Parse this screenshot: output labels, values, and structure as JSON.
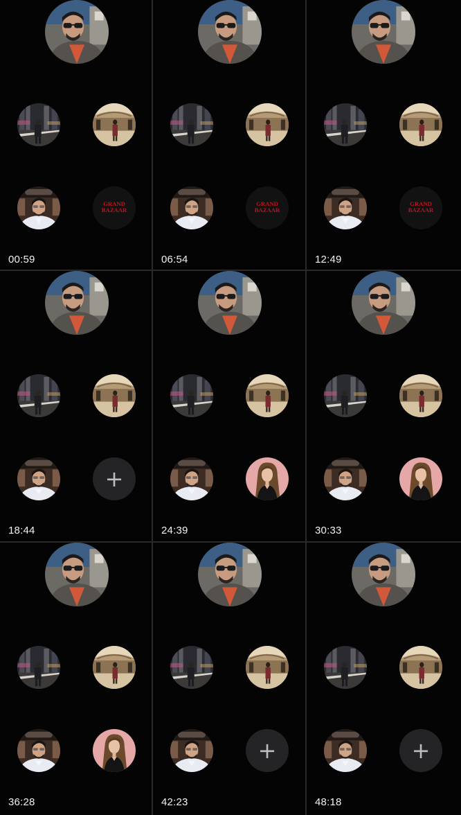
{
  "frames": [
    {
      "timestamp": "00:59",
      "slot4": "grand-bazaar"
    },
    {
      "timestamp": "06:54",
      "slot4": "grand-bazaar"
    },
    {
      "timestamp": "12:49",
      "slot4": "grand-bazaar"
    },
    {
      "timestamp": "18:44",
      "slot4": "add"
    },
    {
      "timestamp": "24:39",
      "slot4": "woman"
    },
    {
      "timestamp": "30:33",
      "slot4": "woman"
    },
    {
      "timestamp": "36:28",
      "slot4": "woman"
    },
    {
      "timestamp": "42:23",
      "slot4": "add"
    },
    {
      "timestamp": "48:18",
      "slot4": "add"
    }
  ],
  "add_button": {
    "glyph": "+",
    "icon": "plus-icon"
  },
  "grand_bazaar": {
    "line1": "GRAND",
    "line2": "BAZAAR"
  },
  "colors": {
    "background": "#000000",
    "divider": "#2a2a2c",
    "add_circle": "#242426",
    "timestamp_text": "#f2f2f2",
    "logo_red": "#c0121c"
  }
}
